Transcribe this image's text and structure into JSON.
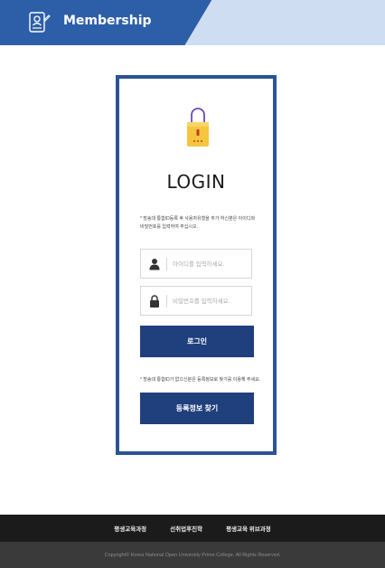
{
  "header": {
    "title": "Membership",
    "icon": "member-card-icon",
    "colors": {
      "band": "#2d5ea8"
    }
  },
  "login": {
    "icon": "lock-icon",
    "title": "LOGIN",
    "notice_top": "* 방송대 통합ID등록 후 사용자유형을 추가 하신분은 아이디와 비밀번호를 입력하여 주십시오.",
    "id_placeholder": "아이디를 입력하세요.",
    "id_value": "",
    "pw_placeholder": "비밀번호를 입력하세요.",
    "pw_value": "",
    "login_button": "로그인",
    "notice_bottom": "* 방송대 통합ID가 없으신분은 등록정보로 찾기를 이용해 주세요.",
    "find_button": "등록정보 찾기",
    "colors": {
      "frame": "#2b5496",
      "button": "#1f3f7d"
    }
  },
  "footer": {
    "links": [
      "평생교육과정",
      "선취업후진학",
      "평생교육 위브과정"
    ],
    "copyright": "Copyright© Korea National Open University Prime College. All Rights Reserved."
  }
}
